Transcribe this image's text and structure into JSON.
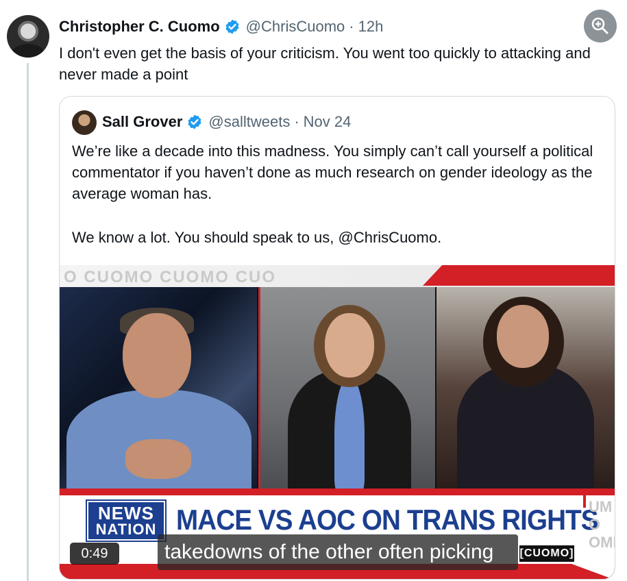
{
  "tweet": {
    "author_name": "Christopher C. Cuomo",
    "handle": "@ChrisCuomo",
    "separator": "·",
    "time": "12h",
    "text": "I don't even get the basis of your criticism. You went too quickly to attacking and never made a point"
  },
  "quote": {
    "author_name": "Sall Grover",
    "handle": "@salltweets",
    "separator": "·",
    "date": "Nov 24",
    "paragraph1": "We’re like a decade into this madness. You simply can’t call yourself a political commentator if you haven’t done as much research on gender ideology as the average woman has.",
    "paragraph2": "We know a lot. You should speak to us, @ChrisCuomo."
  },
  "video": {
    "watermark": "O CUOMO CUOMO CUO",
    "logo_line1": "NEWS",
    "logo_line2": "NATION",
    "headline": "MACE VS AOC ON TRANS RIGHTS",
    "side_ghost": "UM\nO\nOMI",
    "duration": "0:49",
    "caption": "takedowns of the other often picking",
    "show_tag": "[CUOMO]"
  },
  "icons": {
    "verified": "verified-badge-icon",
    "zoom": "zoom-in-icon"
  },
  "colors": {
    "verified_blue": "#1d9bf0",
    "text": "#0f1419",
    "secondary": "#536471",
    "newsnation_blue": "#1c3f8f",
    "newsnation_red": "#d31f26"
  }
}
